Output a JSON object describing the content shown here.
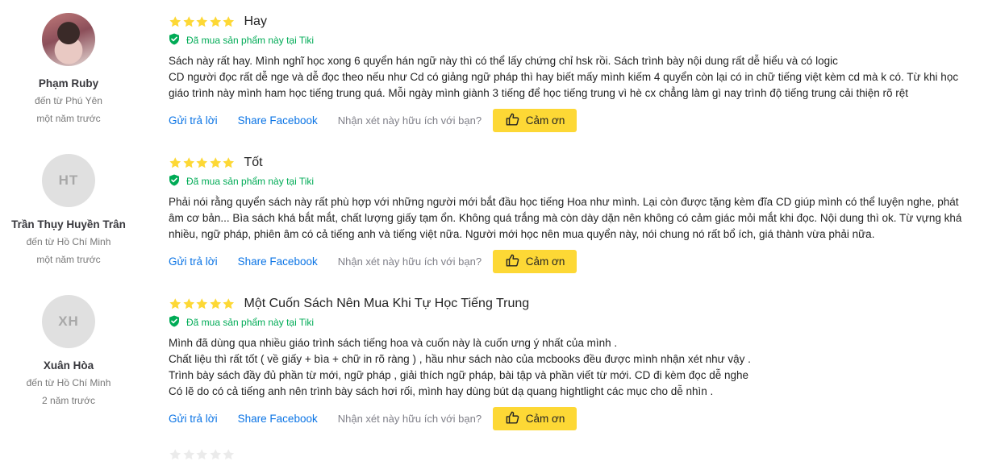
{
  "colors": {
    "star": "#fdd835",
    "verified": "#00ab56",
    "link": "#0b74e5",
    "button": "#fdd835"
  },
  "labels": {
    "verified": "Đã mua sản phẩm này tại Tiki",
    "reply": "Gửi trả lời",
    "share": "Share Facebook",
    "helpful": "Nhận xét này hữu ích với bạn?",
    "thanks": "Cảm ơn"
  },
  "reviews": [
    {
      "user": {
        "name": "Phạm Ruby",
        "from": "đến từ Phú Yên",
        "time": "một năm trước",
        "avatar": "photo"
      },
      "rating": 5,
      "title": "Hay",
      "body": [
        "Sách này rất hay. Mình nghĩ học xong 6 quyển hán ngữ này thì có thể lấy chứng chỉ hsk rồi. Sách trình bày nội dung rất dễ hiểu và có logic",
        "CD người đọc rất dễ nge và dễ đọc theo nếu như Cd có giảng ngữ pháp thì hay biết mấy mình kiếm 4 quyển còn lại có in chữ tiếng việt kèm cd mà k có. Từ khi học giáo trình này mình ham học tiếng trung quá. Mỗi ngày mình giành 3 tiếng để học tiếng trung vì hè cx chẳng làm gì nay trình độ tiếng trung cải thiện rõ rệt"
      ]
    },
    {
      "user": {
        "name": "Trần Thụy Huyền Trân",
        "from": "đến từ Hồ Chí Minh",
        "time": "một năm trước",
        "avatar": "HT"
      },
      "rating": 5,
      "title": "Tốt",
      "body": [
        "Phải nói rằng quyển sách này rất phù hợp với những người mới bắt đầu học tiếng Hoa như mình. Lại còn được tặng kèm đĩa CD giúp mình có thể luyện nghe, phát âm cơ bản... Bìa sách khá bắt mắt, chất lượng giấy tạm ổn. Không quá trắng mà còn dày dặn nên không có cảm giác mỏi mắt khi đọc. Nội dung thì ok. Từ vựng khá nhiều, ngữ pháp, phiên âm có cả tiếng anh và tiếng việt nữa. Người mới học nên mua quyển này, nói chung nó rất bổ ích, giá thành vừa phải nữa."
      ]
    },
    {
      "user": {
        "name": "Xuân Hòa",
        "from": "đến từ Hồ Chí Minh",
        "time": "2 năm trước",
        "avatar": "XH"
      },
      "rating": 5,
      "title": "Một Cuốn Sách Nên Mua Khi Tự Học Tiếng Trung",
      "body": [
        "Mình đã dùng qua nhiều giáo trình sách tiếng hoa và cuốn này là cuốn ưng ý nhất của mình .",
        "Chất liệu thì rất tốt ( về giấy + bìa + chữ in rõ ràng ) , hầu như sách nào của mcbooks đều được mình nhận xét như vậy .",
        "Trình bày sách đầy đủ phần từ mới, ngữ pháp , giải thích ngữ pháp, bài tập và phần viết từ mới. CD đi kèm đọc dễ nghe",
        "Có lẽ do có cả tiếng anh nên trình bày sách hơi rối, mình hay dùng bút dạ quang hightlight các mục cho dễ nhìn ."
      ]
    }
  ]
}
